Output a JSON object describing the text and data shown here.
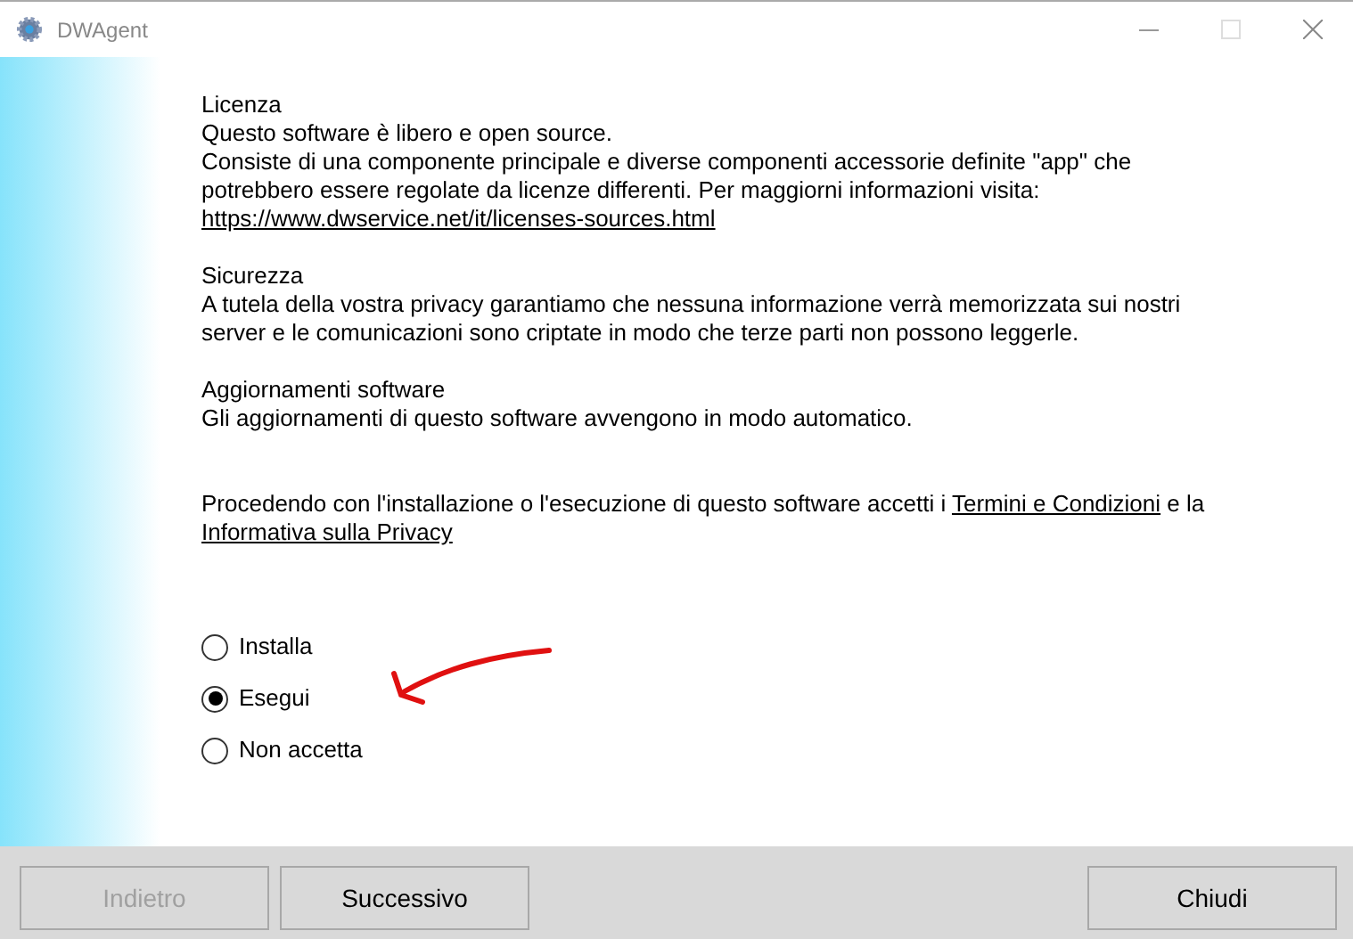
{
  "window": {
    "title": "DWAgent"
  },
  "sections": [
    {
      "title": "Licenza",
      "paragraphs": [
        [
          {
            "kind": "text",
            "text": "Questo software è libero e open source."
          }
        ],
        [
          {
            "kind": "text",
            "text": "Consiste di una componente principale e diverse componenti accessorie definite \"app\" che potrebbero essere regolate da licenze differenti. Per maggiorni informazioni visita: "
          },
          {
            "kind": "link",
            "text": "https://www.dwservice.net/it/licenses-sources.html"
          }
        ]
      ]
    },
    {
      "title": "Sicurezza",
      "paragraphs": [
        [
          {
            "kind": "text",
            "text": "A tutela della vostra privacy garantiamo che nessuna informazione verrà memorizzata sui nostri server e le comunicazioni sono criptate in modo che terze parti non possono leggerle."
          }
        ]
      ]
    },
    {
      "title": "Aggiornamenti software",
      "paragraphs": [
        [
          {
            "kind": "text",
            "text": "Gli aggiornamenti di questo software avvengono in modo automatico."
          }
        ]
      ]
    }
  ],
  "notice": [
    {
      "kind": "text",
      "text": "Procedendo con l'installazione o l'esecuzione di questo software accetti i "
    },
    {
      "kind": "link",
      "text": "Termini e Condizioni"
    },
    {
      "kind": "text",
      "text": " e la "
    },
    {
      "kind": "link",
      "text": "Informativa sulla Privacy"
    }
  ],
  "options": [
    {
      "label": "Installa",
      "selected": false
    },
    {
      "label": "Esegui",
      "selected": true
    },
    {
      "label": "Non accetta",
      "selected": false
    }
  ],
  "buttons_left": [
    {
      "label": "Indietro",
      "disabled": true
    },
    {
      "label": "Successivo",
      "disabled": false
    }
  ],
  "buttons_right": [
    {
      "label": "Chiudi",
      "disabled": false
    }
  ]
}
